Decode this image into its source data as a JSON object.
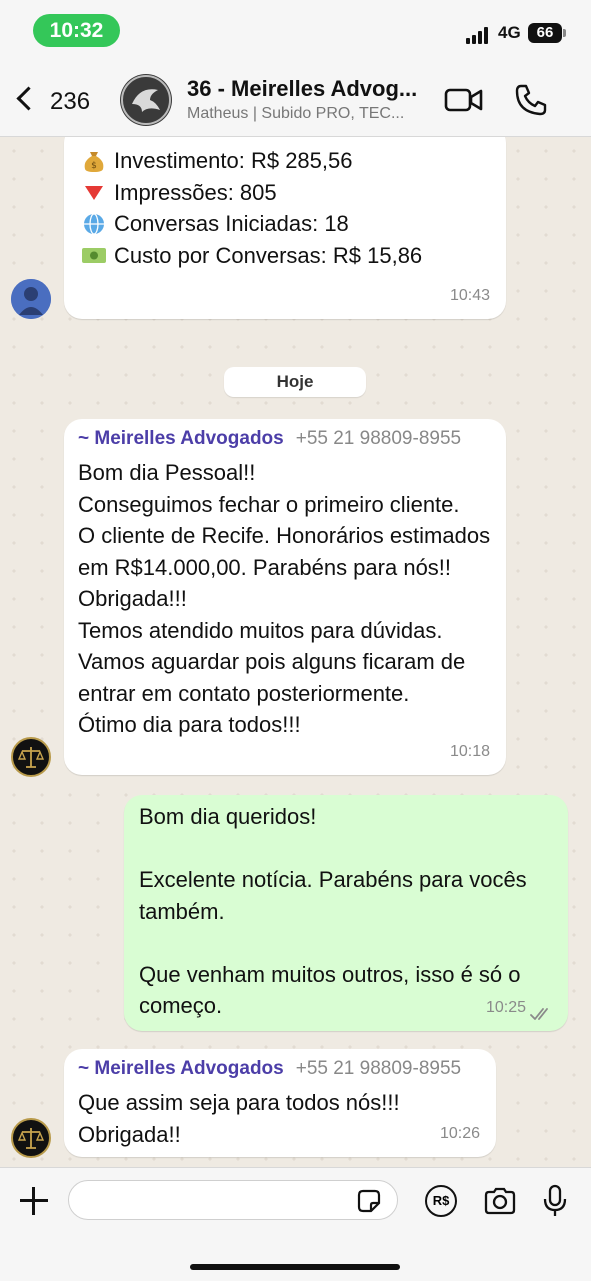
{
  "status": {
    "time": "10:32",
    "network": "4G",
    "battery": "66"
  },
  "header": {
    "back_count": "236",
    "title": "36 - Meirelles Advog...",
    "subtitle": "Matheus | Subido PRO, TEC..."
  },
  "messages": {
    "m1": {
      "rows": [
        {
          "emoji": "money-bag",
          "text": "Investimento: R$ 285,56"
        },
        {
          "emoji": "red-triangle",
          "text": "Impressões: 805"
        },
        {
          "emoji": "globe",
          "text": "Conversas Iniciadas: 18"
        },
        {
          "emoji": "banknote",
          "text": "Custo por Conversas: R$ 15,86"
        }
      ],
      "time": "10:43"
    },
    "date_chip": "Hoje",
    "m2": {
      "sender": "~ Meirelles Advogados",
      "phone": "+55 21 98809-8955",
      "text": "Bom dia Pessoal!!\nConseguimos fechar o primeiro cliente.\nO cliente de Recife.  Honorários estimados em R$14.000,00. Parabéns para nós!! Obrigada!!!\nTemos atendido muitos para dúvidas. Vamos aguardar pois alguns ficaram de entrar em contato posteriormente.\nÓtimo dia para todos!!!",
      "time": "10:18"
    },
    "m3": {
      "text": "Bom dia queridos!\n\nExcelente notícia. Parabéns para vocês também.\n\nQue venham muitos outros, isso é só o começo.",
      "time": "10:25",
      "status": "read"
    },
    "m4": {
      "sender": "~ Meirelles Advogados",
      "phone": "+55 21 98809-8955",
      "text": "Que assim seja para todos nós!!!\nObrigada!!",
      "time": "10:26"
    }
  },
  "input": {
    "value": "",
    "placeholder": "",
    "pay_label": "R$"
  },
  "colors": {
    "accent_green": "#34c759",
    "outgoing_bubble": "#d9fdd3",
    "sender_name": "#4c3ea8",
    "read_ticks": "#8a8a8a"
  }
}
